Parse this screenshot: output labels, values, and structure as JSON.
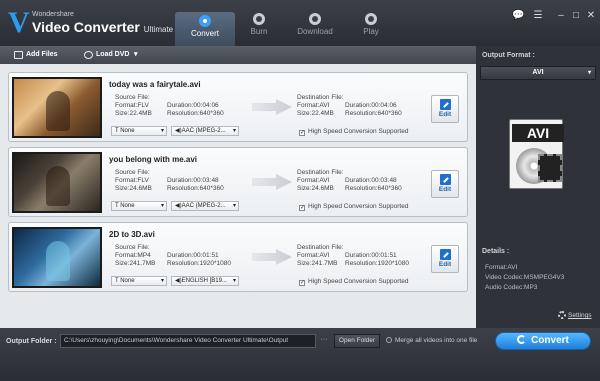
{
  "app": {
    "brand": "Wondershare",
    "name": "Video Converter",
    "edition": "Ultimate"
  },
  "tabs": [
    {
      "label": "Convert",
      "icon": "convert-icon",
      "active": true
    },
    {
      "label": "Burn",
      "icon": "burn-icon"
    },
    {
      "label": "Download",
      "icon": "download-icon"
    },
    {
      "label": "Play",
      "icon": "play-icon"
    }
  ],
  "window_controls": {
    "feedback": "💬",
    "menu": "☰",
    "minimize": "–",
    "restore": "□",
    "close": "✕"
  },
  "toolbar": {
    "add_files": "Add Files",
    "load_dvd": "Load DVD",
    "dropdown": "▾"
  },
  "files": [
    {
      "name": "today was a fairytale.avi",
      "source": {
        "title": "Source File:",
        "format": "Format:FLV",
        "size": "Size:22.4MB",
        "duration": "Duration:00:04:06",
        "resolution": "Resolution:640*360"
      },
      "destination": {
        "title": "Destination File:",
        "format": "Format:AVI",
        "size": "Size:22.4MB",
        "duration": "Duration:00:04:06",
        "resolution": "Resolution:640*360"
      },
      "subtitle": "T None",
      "audio": "◀)AAC (MPEG-2...",
      "high_speed": "High Speed Conversion Supported",
      "edit": "Edit"
    },
    {
      "name": "you belong with me.avi",
      "source": {
        "title": "Source File:",
        "format": "Format:FLV",
        "size": "Size:24.6MB",
        "duration": "Duration:00:03:48",
        "resolution": "Resolution:640*360"
      },
      "destination": {
        "title": "Destination File:",
        "format": "Format:AVI",
        "size": "Size:24.6MB",
        "duration": "Duration:00:03:48",
        "resolution": "Resolution:640*360"
      },
      "subtitle": "T None",
      "audio": "◀)AAC (MPEG-2...",
      "high_speed": "High Speed Conversion Supported",
      "edit": "Edit"
    },
    {
      "name": "2D to 3D.avi",
      "source": {
        "title": "Source File:",
        "format": "Format:MP4",
        "size": "Size:241.7MB",
        "duration": "Duration:00:01:51",
        "resolution": "Resolution:1920*1080"
      },
      "destination": {
        "title": "Destination File:",
        "format": "Format:AVI",
        "size": "Size:241.7MB",
        "duration": "Duration:00:01:51",
        "resolution": "Resolution:1920*1080"
      },
      "subtitle": "T None",
      "audio": "◀)ENGLISH [B19...",
      "high_speed": "High Speed Conversion Supported",
      "edit": "Edit"
    }
  ],
  "output_format": {
    "label": "Output Format :",
    "selected": "AVI",
    "preview_tag": "AVI",
    "details_label": "Details :",
    "details": [
      "Format:AVI",
      "Video Codec:MSMPEG4V3",
      "Audio Codec:MP3"
    ],
    "settings": "Settings"
  },
  "bottom": {
    "output_folder_label": "Output Folder :",
    "output_path": "C:\\Users\\zhouying\\Documents\\Wondershare Video Converter Ultimate\\Output",
    "browse": "···",
    "open_folder": "Open Folder",
    "merge": "Merge all videos into one file",
    "convert": "Convert"
  },
  "colors": {
    "accent": "#2b9bf0",
    "convert_button": "#1f7fdc"
  }
}
